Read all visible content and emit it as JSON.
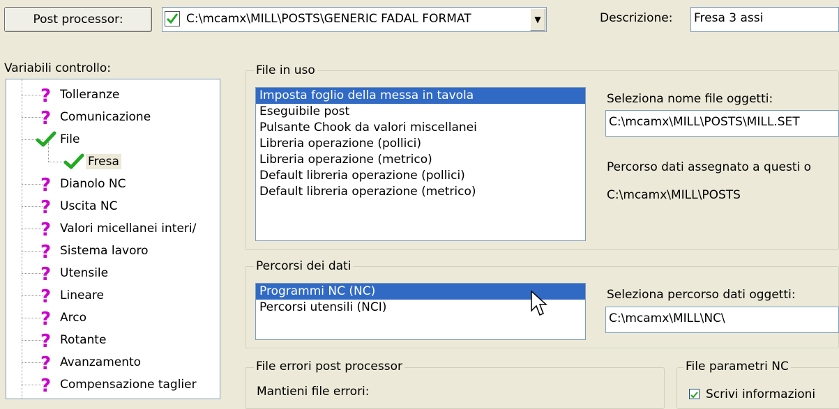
{
  "top": {
    "post_processor_button": "Post processor:",
    "post_processor_value": "C:\\mcamx\\MILL\\POSTS\\GENERIC FADAL FORMAT",
    "description_label": "Descrizione:",
    "description_value": "Fresa 3 assi"
  },
  "tree": {
    "label": "Variabili controllo:",
    "items": [
      {
        "label": "Tolleranze",
        "icon": "question-icon"
      },
      {
        "label": "Comunicazione",
        "icon": "question-icon"
      },
      {
        "label": "File",
        "icon": "check-icon"
      },
      {
        "label": "Fresa",
        "icon": "check-icon",
        "selected": true
      },
      {
        "label": "Dianolo NC",
        "icon": "question-icon"
      },
      {
        "label": "Uscita NC",
        "icon": "question-icon"
      },
      {
        "label": "Valori micellanei interi/",
        "icon": "question-icon"
      },
      {
        "label": "Sistema lavoro",
        "icon": "question-icon"
      },
      {
        "label": "Utensile",
        "icon": "question-icon"
      },
      {
        "label": "Lineare",
        "icon": "question-icon"
      },
      {
        "label": "Arco",
        "icon": "question-icon"
      },
      {
        "label": "Rotante",
        "icon": "question-icon"
      },
      {
        "label": "Avanzamento",
        "icon": "question-icon"
      },
      {
        "label": "Compensazione taglier",
        "icon": "question-icon"
      }
    ]
  },
  "files_in_use": {
    "title": "File in uso",
    "items": [
      "Imposta foglio della messa in tavola",
      "Eseguibile post",
      "Pulsante Chook da valori miscellanei",
      "Libreria operazione (pollici)",
      "Libreria operazione (metrico)",
      "Default libreria operazione (pollici)",
      "Default libreria operazione (metrico)"
    ],
    "selected_index": 0,
    "select_label": "Seleziona nome file oggetti:",
    "select_value": "C:\\mcamx\\MILL\\POSTS\\MILL.SET",
    "path_label": "Percorso dati assegnato a questi o",
    "path_value": "C:\\mcamx\\MILL\\POSTS"
  },
  "data_paths": {
    "title": "Percorsi dei dati",
    "items": [
      "Programmi NC (NC)",
      "Percorsi utensili (NCI)"
    ],
    "selected_index": 0,
    "select_label": "Seleziona percorso dati oggetti:",
    "select_value": "C:\\mcamx\\MILL\\NC\\"
  },
  "errors": {
    "title": "File errori post processor",
    "keep_label": "Mantieni file errori:"
  },
  "nc_params": {
    "title": "File parametri NC",
    "write_info_label": "Scrivi informazioni"
  },
  "colors": {
    "selection": "#316ac5",
    "question_icon": "#cc00cc",
    "check_icon": "#22aa22",
    "window_bg": "#ece9d8"
  }
}
